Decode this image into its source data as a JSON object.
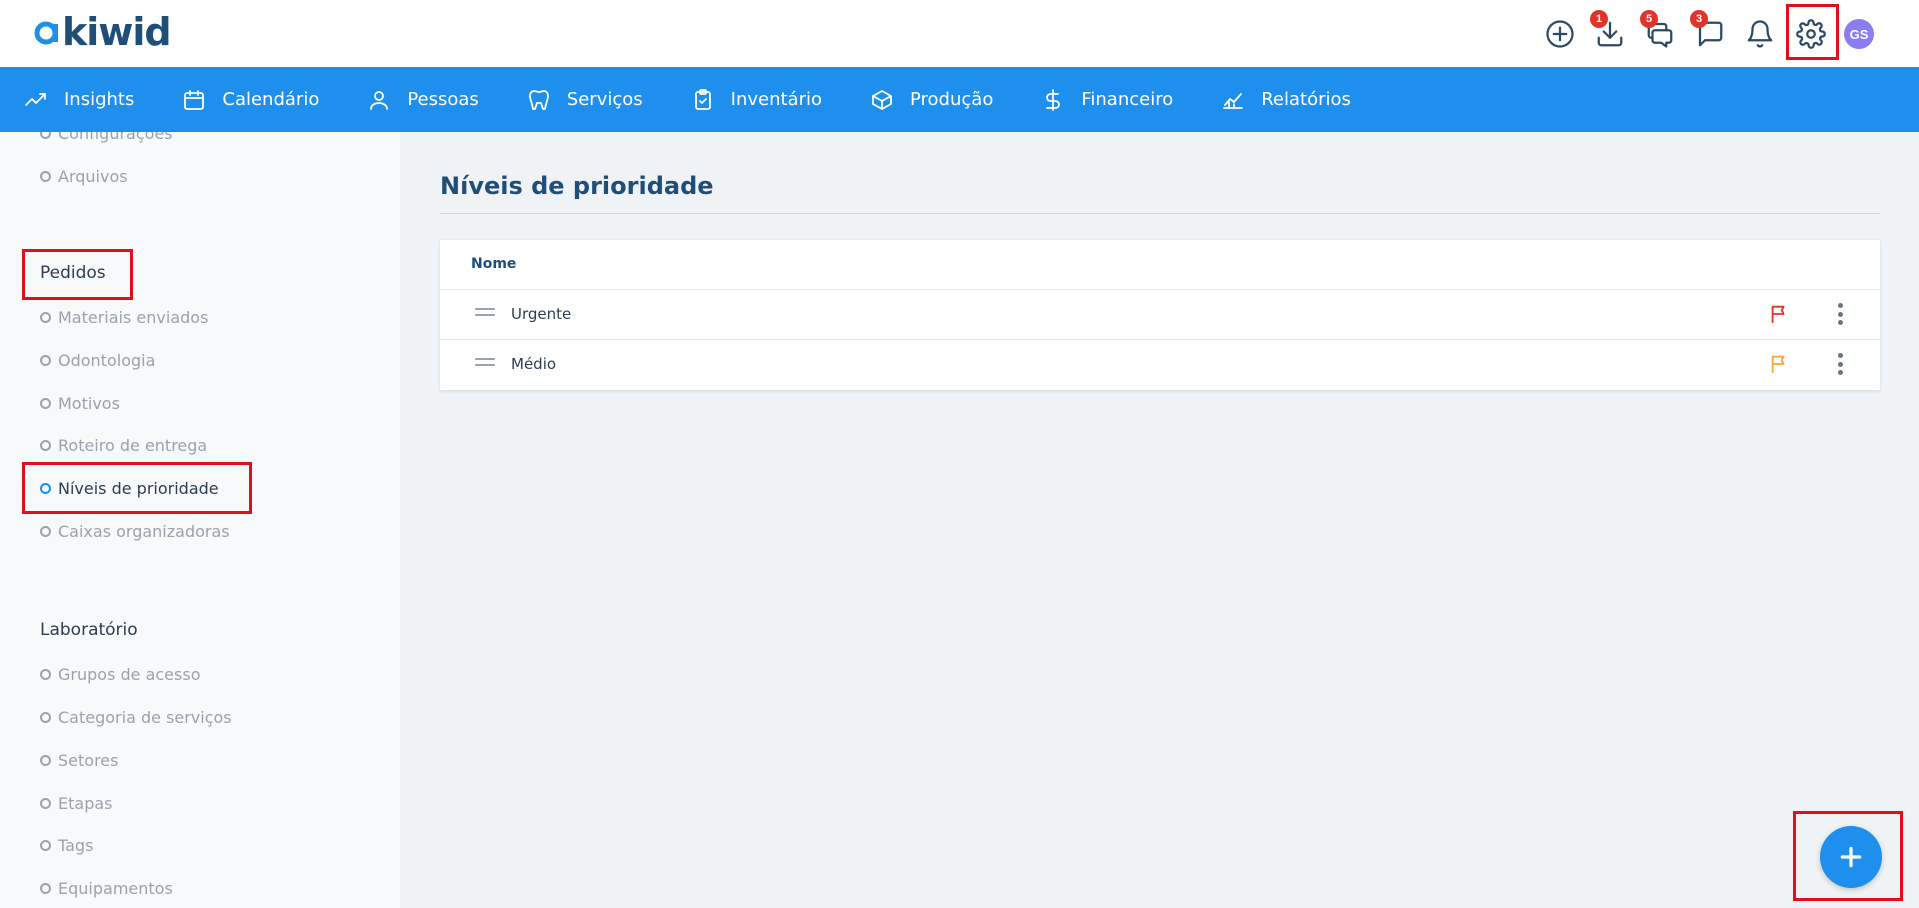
{
  "brand": {
    "logo_text": "kiwid"
  },
  "header": {
    "badges": {
      "downloads": "1",
      "chats": "5",
      "messages": "3"
    },
    "avatar_initials": "GS"
  },
  "nav": {
    "items": [
      {
        "label": "Insights",
        "icon": "trend-icon"
      },
      {
        "label": "Calendário",
        "icon": "calendar-icon"
      },
      {
        "label": "Pessoas",
        "icon": "person-icon"
      },
      {
        "label": "Serviços",
        "icon": "tooth-icon"
      },
      {
        "label": "Inventário",
        "icon": "clipboard-icon"
      },
      {
        "label": "Produção",
        "icon": "box-icon"
      },
      {
        "label": "Financeiro",
        "icon": "dollar-icon"
      },
      {
        "label": "Relatórios",
        "icon": "report-icon"
      }
    ]
  },
  "sidebar": {
    "top_items": [
      "Configurações",
      "Arquivos"
    ],
    "pedidos": {
      "title": "Pedidos",
      "items": [
        "Materiais enviados",
        "Odontologia",
        "Motivos",
        "Roteiro de entrega",
        "Níveis de prioridade",
        "Caixas organizadoras"
      ],
      "active": "Níveis de prioridade"
    },
    "laboratorio": {
      "title": "Laboratório",
      "items": [
        "Grupos de acesso",
        "Categoria de serviços",
        "Setores",
        "Etapas",
        "Tags",
        "Equipamentos"
      ]
    }
  },
  "main": {
    "title": "Níveis de prioridade",
    "table": {
      "header_name": "Nome",
      "rows": [
        {
          "name": "Urgente",
          "flag_color": "#e0342b"
        },
        {
          "name": "Médio",
          "flag_color": "#f5a742"
        }
      ]
    }
  },
  "colors": {
    "primary": "#1e8fec",
    "highlight": "#e0101b",
    "title": "#1f4e79"
  }
}
